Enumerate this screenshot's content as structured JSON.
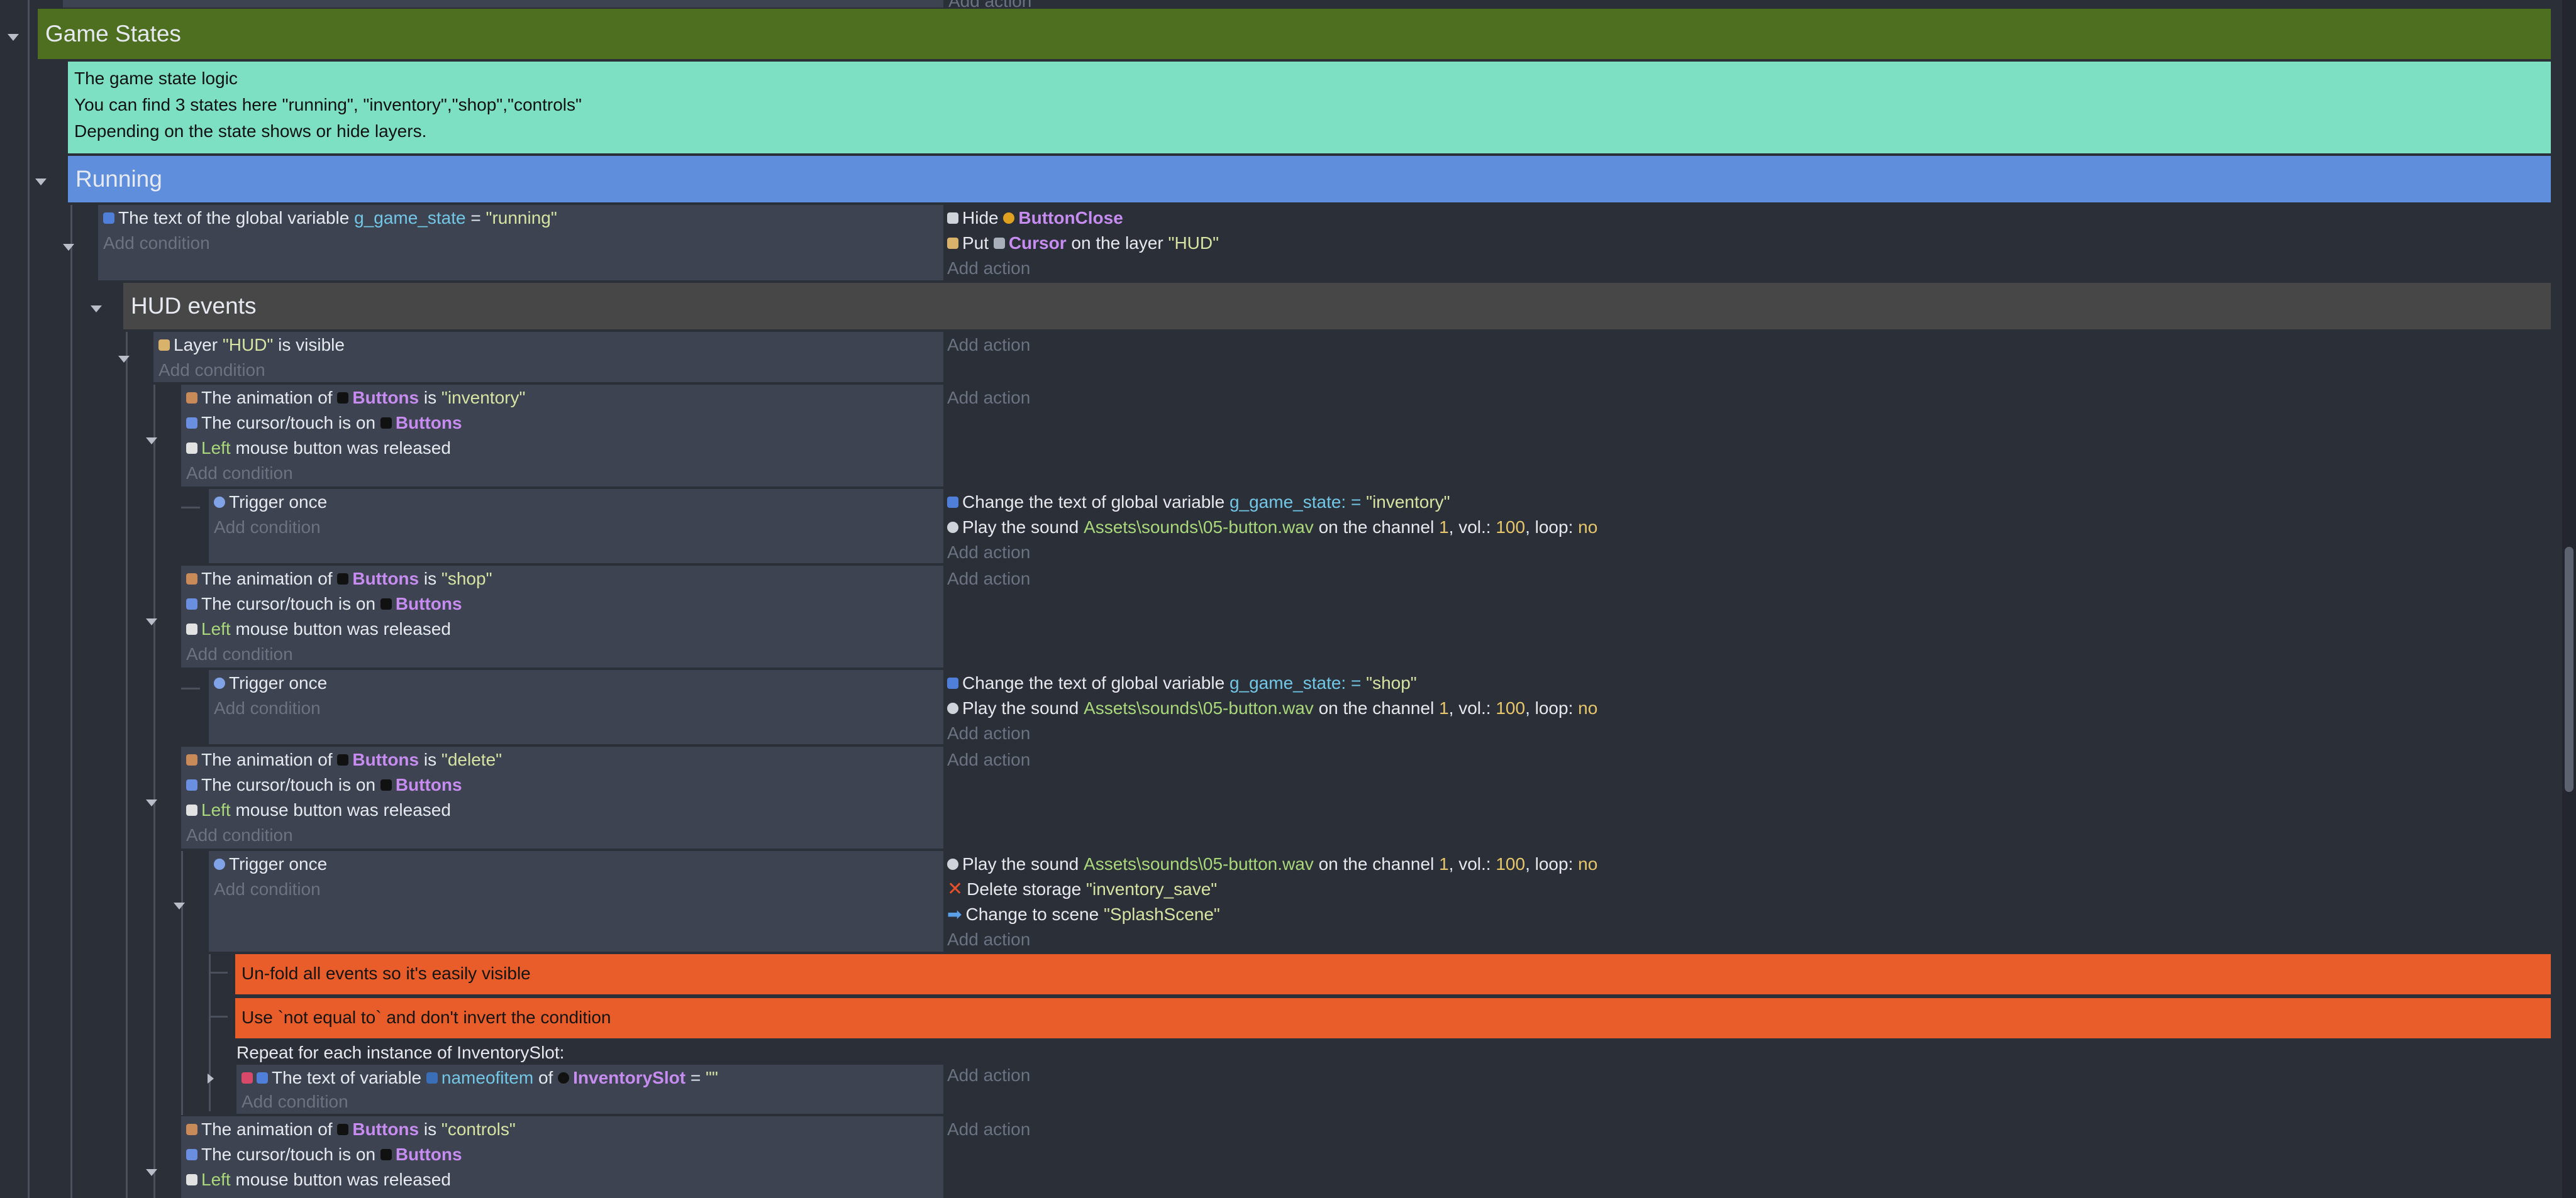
{
  "top_add_action": "Add action",
  "group_game_states": {
    "title": "Game States",
    "color": "#4e6f1f"
  },
  "comment_top": {
    "lines": [
      "The game state logic",
      "You can find 3 states here \"running\", \"inventory\",\"shop\",\"controls\"",
      "Depending on the state shows or hide layers."
    ],
    "color": "#7de0c3"
  },
  "group_running": {
    "title": "Running",
    "color": "#5f8fdc"
  },
  "group_hud": {
    "title": "HUD events",
    "color": "#474747"
  },
  "common": {
    "add_condition": "Add condition",
    "add_action": "Add action",
    "trigger_once": "Trigger once",
    "the_animation_of": "The animation of",
    "is": "is",
    "cursor_on": "The cursor/touch is on",
    "left": "Left",
    "mouse_released": "mouse button was released",
    "buttons": "Buttons",
    "change_text_global": "Change the text of global variable",
    "g_game_state": "g_game_state",
    "set_eq": ": =",
    "play_sound": "Play the sound",
    "sound_path": "Assets\\sounds\\05-button.wav",
    "on_channel": "on the channel",
    "channel": "1",
    "vol": ", vol.:",
    "vol_val": "100",
    "loop": ", loop:",
    "loop_val": "no"
  },
  "running_event": {
    "cond_prefix": "The text of the global variable",
    "cond_var": "g_game_state",
    "cond_op": "=",
    "cond_val": "\"running\"",
    "act1_verb": "Hide",
    "act1_obj": "ButtonClose",
    "act2_verb": "Put",
    "act2_obj": "Cursor",
    "act2_mid": "on the layer",
    "act2_val": "\"HUD\""
  },
  "hud_event": {
    "prefix": "Layer",
    "val": "\"HUD\"",
    "suffix": "is visible"
  },
  "inventory": {
    "anim": "\"inventory\"",
    "set_val": "\"inventory\""
  },
  "shop": {
    "anim": "\"shop\"",
    "set_val": "\"shop\""
  },
  "delete": {
    "anim": "\"delete\"",
    "delete_label": "Delete storage",
    "delete_val": "\"inventory_save\"",
    "scene_label": "Change to scene",
    "scene_val": "\"SplashScene\""
  },
  "comment_unfold": {
    "text": "Un-fold all events so it's easily visible",
    "color": "#e85d2a"
  },
  "comment_notequal": {
    "text": "Use `not equal to` and don't invert the condition",
    "color": "#e85d2a"
  },
  "repeat": {
    "header": "Repeat for each instance of InventorySlot:",
    "prefix": "The text of variable",
    "var": "nameofitem",
    "of": "of",
    "obj": "InventorySlot",
    "op": "=",
    "val": "\"\""
  },
  "controls": {
    "anim": "\"controls\""
  }
}
